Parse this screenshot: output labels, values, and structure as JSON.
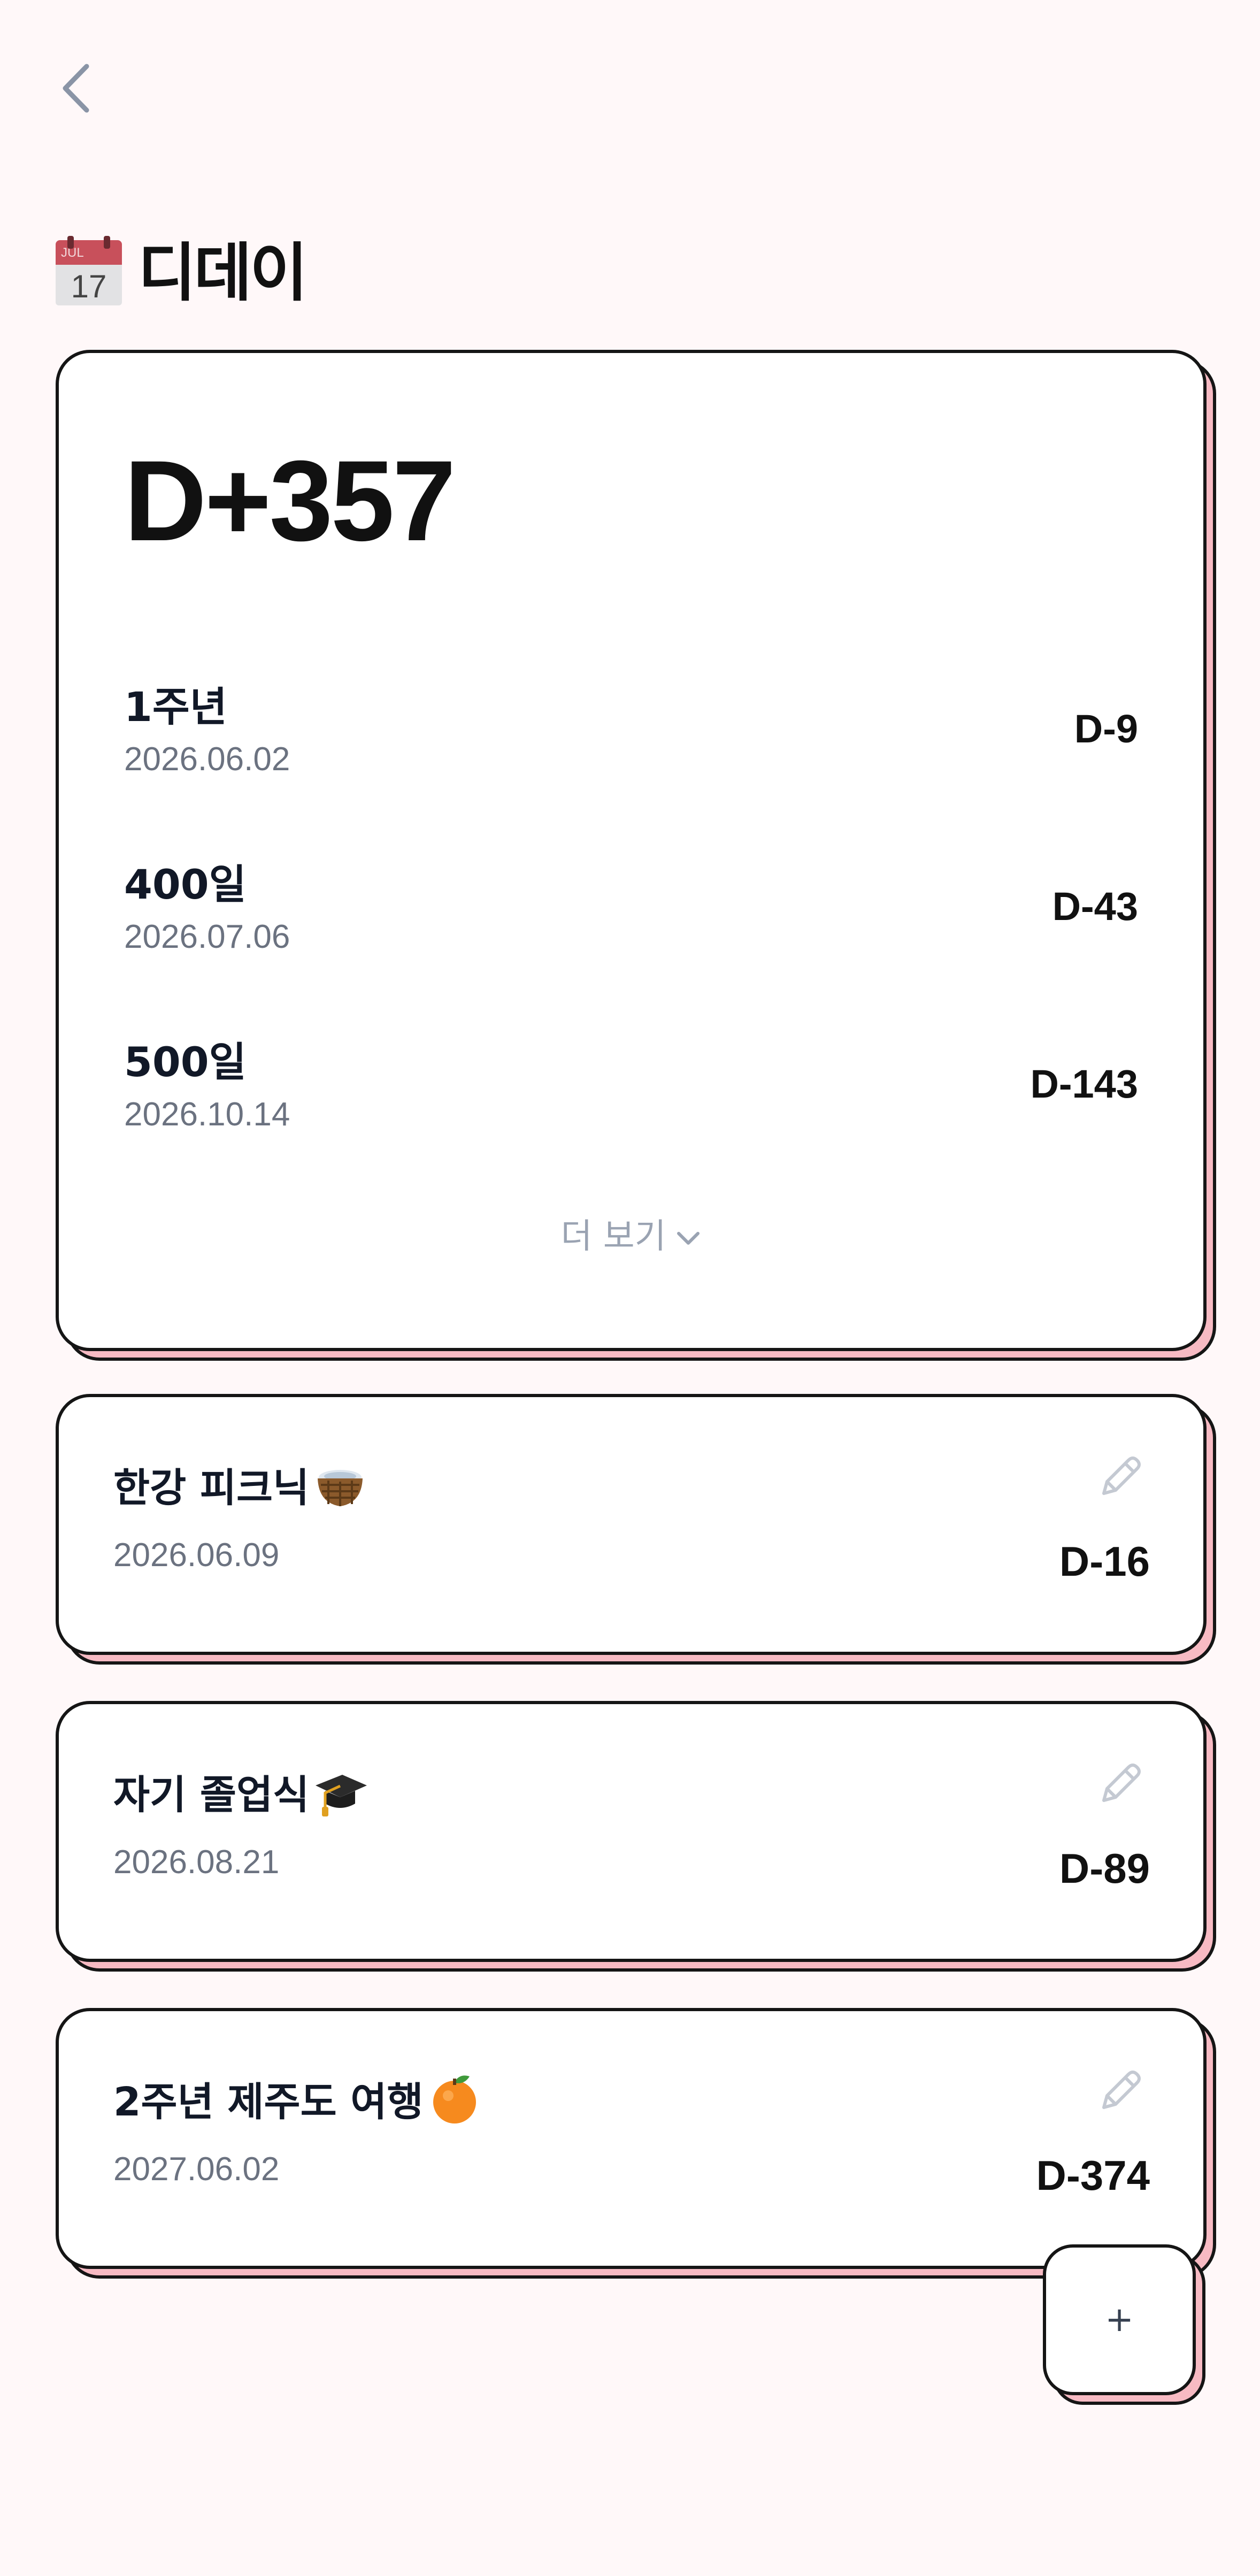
{
  "header": {
    "back_icon": "chevron-left-icon",
    "title_icon": "calendar-icon",
    "calendar_month": "JUL",
    "calendar_day": "17",
    "title": "디데이"
  },
  "main_card": {
    "dday": "D+357",
    "milestones": [
      {
        "label": "1주년",
        "date": "2026.06.02",
        "dday": "D-9"
      },
      {
        "label": "400일",
        "date": "2026.07.06",
        "dday": "D-43"
      },
      {
        "label": "500일",
        "date": "2026.10.14",
        "dday": "D-143"
      }
    ],
    "more_label": "더 보기"
  },
  "events": [
    {
      "title": "한강 피크닉",
      "emoji": "basket-icon",
      "date": "2026.06.09",
      "dday": "D-16"
    },
    {
      "title": "자기 졸업식",
      "emoji": "graduation-cap-icon",
      "date": "2026.08.21",
      "dday": "D-89"
    },
    {
      "title": "2주년 제주도 여행",
      "emoji": "tangerine-icon",
      "date": "2027.06.02",
      "dday": "D-374"
    }
  ],
  "fab": {
    "label": "+"
  },
  "colors": {
    "background": "#fff8f9",
    "card_shadow": "#f7bac3",
    "border": "#151515",
    "muted_text": "#6b7280"
  }
}
